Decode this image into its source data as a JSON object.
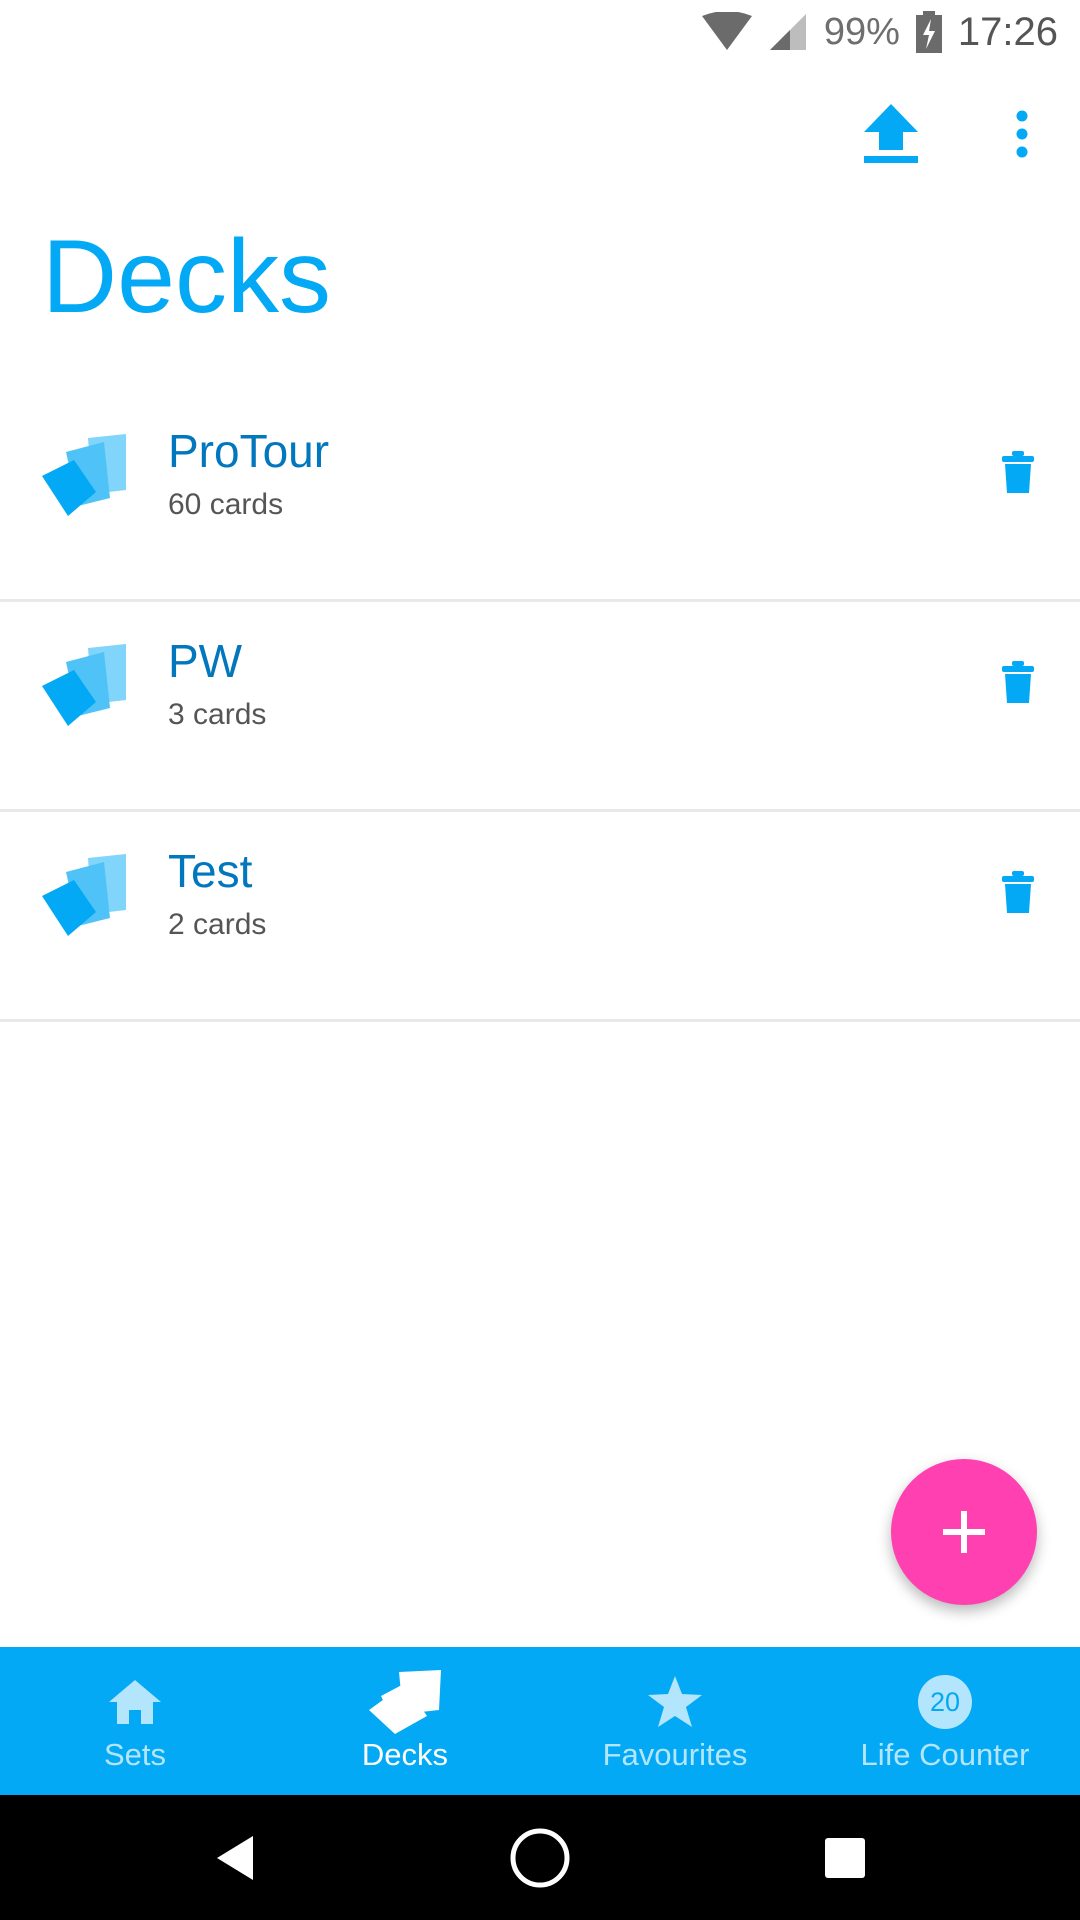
{
  "status_bar": {
    "battery": "99%",
    "time": "17:26"
  },
  "toolbar": {
    "upload_icon": "upload-icon",
    "more_icon": "more-vert-icon"
  },
  "page": {
    "title": "Decks"
  },
  "decks": [
    {
      "name": "ProTour",
      "count": "60 cards"
    },
    {
      "name": "PW",
      "count": "3 cards"
    },
    {
      "name": "Test",
      "count": "2 cards"
    }
  ],
  "fab": {
    "icon": "add-icon",
    "color": "#ff40b0"
  },
  "bottom_nav": {
    "items": [
      {
        "label": "Sets",
        "icon": "home-icon",
        "active": false
      },
      {
        "label": "Decks",
        "icon": "cards-icon",
        "active": true
      },
      {
        "label": "Favourites",
        "icon": "star-icon",
        "active": false
      },
      {
        "label": "Life Counter",
        "icon": "life-counter-icon",
        "badge": "20",
        "active": false
      }
    ]
  },
  "colors": {
    "accent": "#03a9f4",
    "deck_name": "#0277bd",
    "fab": "#ff40b0"
  }
}
